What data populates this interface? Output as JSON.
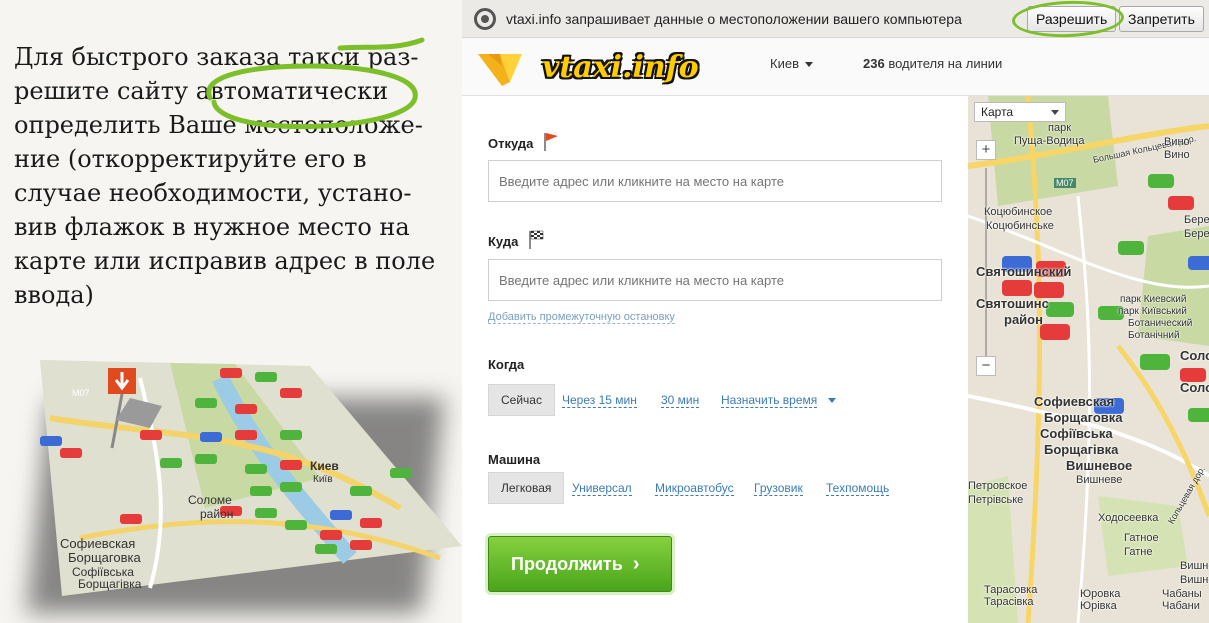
{
  "promo": {
    "lines": [
      "Для быстрого заказа такси раз-",
      "решите сайту автоматически",
      "определить Ваше местоположе-",
      "ние (откорректируйте его в",
      "случае необходимости, устано-",
      "вив флажок в нужное место на",
      "карте или исправив адрес в поле",
      "ввода)"
    ]
  },
  "geo_bar": {
    "icon": "location-target-icon",
    "message": "vtaxi.info запрашивает данные о местоположении вашего компьютера",
    "allow_label": "Разрешить",
    "deny_label": "Запретить"
  },
  "header": {
    "logo_text": "vtaxi.info",
    "city": "Киев",
    "drivers_count": "236",
    "drivers_label": "водителя на линии"
  },
  "form": {
    "from_label": "Откуда",
    "from_placeholder": "Введите адрес или кликните на место на карте",
    "to_label": "Куда",
    "to_placeholder": "Введите адрес или кликните на место на карте",
    "add_stop": "Добавить промежуточную остановку",
    "when_label": "Когда",
    "when_options": [
      "Сейчас",
      "Через 15 мин",
      "30 мин",
      "Назначить время"
    ],
    "when_selected": 0,
    "car_label": "Машина",
    "car_options": [
      "Легковая",
      "Универсал",
      "Микроавтобус",
      "Грузовик",
      "Техпомощь"
    ],
    "car_selected": 0,
    "continue_label": "Продолжить"
  },
  "map": {
    "type_select": "Карта",
    "labels": [
      "парк",
      "Пуща-Водица",
      "Большая Кольцевая дор.",
      "Вино",
      "Вино",
      "М07",
      "Коцюбинское",
      "Коцюбинське",
      "Бере",
      "Бере",
      "Святошинский",
      "Святошинс",
      "район",
      "парк Киевский",
      "парк Київський",
      "Ботанический",
      "Ботанічний",
      "Соло",
      "Соло",
      "Софиевская",
      "Борщаговка",
      "Софіївська",
      "Борщагівка",
      "Вишневое",
      "Вишневе",
      "Петровское",
      "Петрівське",
      "Кольцевая дор.",
      "Тарасовка",
      "Тарасівка",
      "Юровка",
      "Юрівка",
      "Чабаны",
      "Чабани",
      "Ходосеевка",
      "Гатное",
      "Гатне",
      "Вишнево",
      "Вишнёво"
    ]
  },
  "mini_map_labels": [
    "Киев",
    "Київ",
    "Соломе",
    "район",
    "Софиевская",
    "Борщаговка",
    "Софіївська",
    "Борщагівка",
    "М07"
  ],
  "colors": {
    "accent_green": "#5cb82a",
    "link_blue": "#3a7bb8",
    "flag_red": "#e04a1f",
    "logo_yellow": "#ffcc00"
  }
}
